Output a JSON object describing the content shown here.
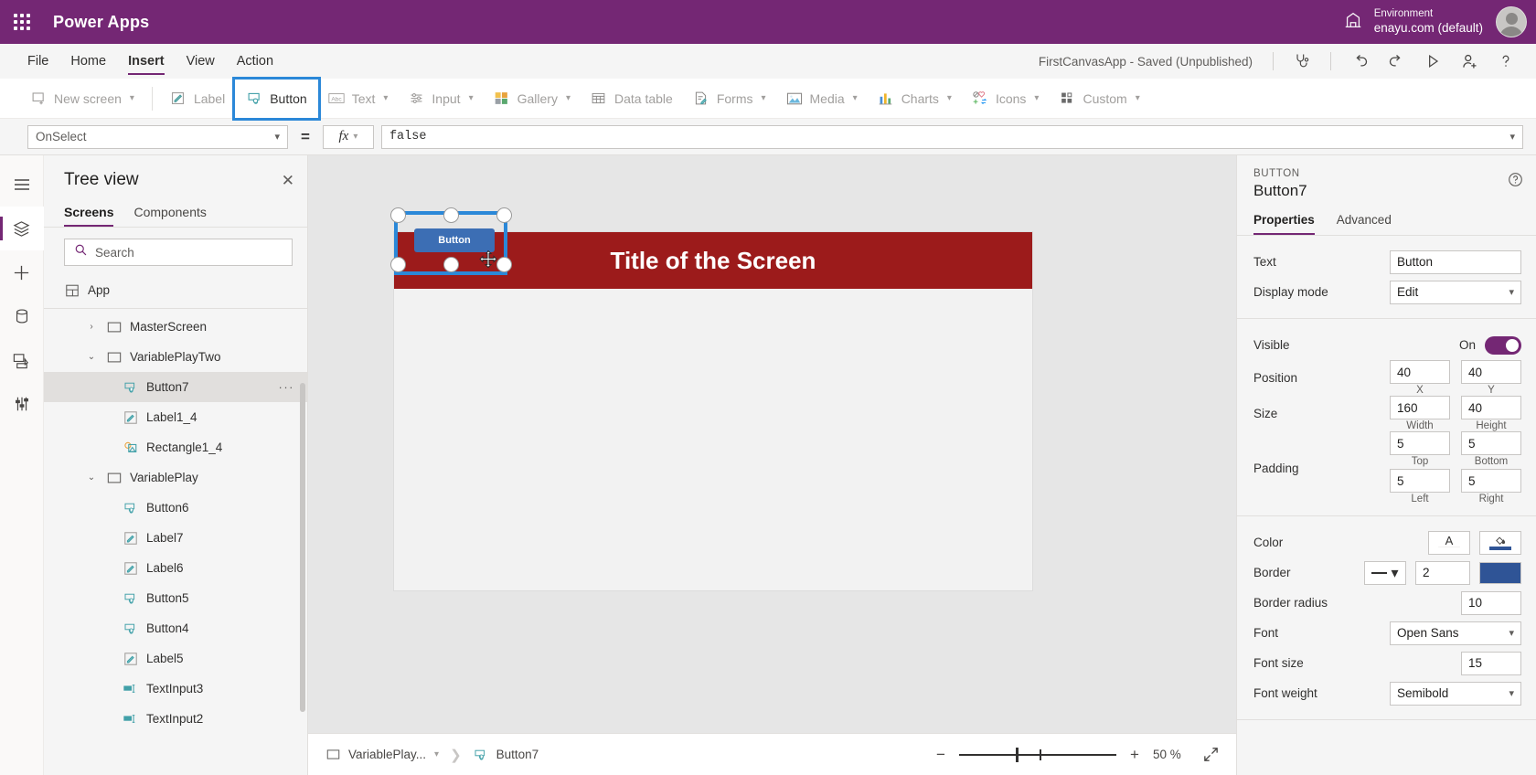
{
  "topbar": {
    "waffle_icon": "app-launcher-icon",
    "brand": "Power Apps",
    "environment_icon": "environment-icon",
    "environment_label": "Environment",
    "environment_name": "enayu.com (default)",
    "avatar": "user-avatar"
  },
  "menubar": {
    "items": [
      {
        "label": "File",
        "active": false
      },
      {
        "label": "Home",
        "active": false
      },
      {
        "label": "Insert",
        "active": true
      },
      {
        "label": "View",
        "active": false
      },
      {
        "label": "Action",
        "active": false
      }
    ],
    "app_status": "FirstCanvasApp - Saved (Unpublished)",
    "icons": [
      {
        "name": "app-checker-icon",
        "glyph": "⚕"
      },
      {
        "name": "undo-icon",
        "glyph": "↶"
      },
      {
        "name": "redo-icon",
        "glyph": "↷"
      },
      {
        "name": "preview-play-icon",
        "glyph": "▷"
      },
      {
        "name": "share-user-icon",
        "glyph": "&"
      },
      {
        "name": "help-icon",
        "glyph": "?"
      }
    ]
  },
  "ribbon": {
    "items": [
      {
        "label": "New screen",
        "icon": "new-screen-icon",
        "caret": true,
        "selected": false
      },
      {
        "label": "Label",
        "icon": "label-icon",
        "caret": false,
        "selected": false
      },
      {
        "label": "Button",
        "icon": "button-icon",
        "caret": false,
        "selected": true
      },
      {
        "label": "Text",
        "icon": "text-icon",
        "caret": true,
        "selected": false
      },
      {
        "label": "Input",
        "icon": "input-icon",
        "caret": true,
        "selected": false
      },
      {
        "label": "Gallery",
        "icon": "gallery-icon",
        "caret": true,
        "selected": false
      },
      {
        "label": "Data table",
        "icon": "data-table-icon",
        "caret": false,
        "selected": false
      },
      {
        "label": "Forms",
        "icon": "forms-icon",
        "caret": true,
        "selected": false
      },
      {
        "label": "Media",
        "icon": "media-icon",
        "caret": true,
        "selected": false
      },
      {
        "label": "Charts",
        "icon": "charts-icon",
        "caret": true,
        "selected": false
      },
      {
        "label": "Icons",
        "icon": "icons-icon",
        "caret": true,
        "selected": false
      },
      {
        "label": "Custom",
        "icon": "custom-icon",
        "caret": true,
        "selected": false
      }
    ],
    "selection_color": "#2b88d8"
  },
  "formula_bar": {
    "property": "OnSelect",
    "equals": "=",
    "fx_label": "fx",
    "value": "false"
  },
  "rail": {
    "items": [
      {
        "name": "hamburger-menu-icon"
      },
      {
        "name": "tree-view-icon",
        "active": true
      },
      {
        "name": "insert-plus-icon"
      },
      {
        "name": "data-sources-icon"
      },
      {
        "name": "media-library-icon"
      },
      {
        "name": "advanced-tools-icon"
      }
    ]
  },
  "tree_view": {
    "title": "Tree view",
    "close_icon": "close-icon",
    "tabs": [
      {
        "label": "Screens",
        "active": true
      },
      {
        "label": "Components",
        "active": false
      }
    ],
    "search_placeholder": "Search",
    "search_icon": "search-icon",
    "app_item": {
      "label": "App",
      "icon": "app-icon"
    },
    "items": [
      {
        "label": "MasterScreen",
        "icon": "screen-icon",
        "level": "screen",
        "twisty": "›",
        "selected": false,
        "dots": false
      },
      {
        "label": "VariablePlayTwo",
        "icon": "screen-icon",
        "level": "screen",
        "twisty": "⌄",
        "selected": false,
        "dots": false
      },
      {
        "label": "Button7",
        "icon": "button-icon",
        "level": "ctrl",
        "twisty": "",
        "selected": true,
        "dots": true
      },
      {
        "label": "Label1_4",
        "icon": "label-icon",
        "level": "ctrl",
        "twisty": "",
        "selected": false,
        "dots": false
      },
      {
        "label": "Rectangle1_4",
        "icon": "shape-icon",
        "level": "ctrl",
        "twisty": "",
        "selected": false,
        "dots": false
      },
      {
        "label": "VariablePlay",
        "icon": "screen-icon",
        "level": "screen",
        "twisty": "⌄",
        "selected": false,
        "dots": false
      },
      {
        "label": "Button6",
        "icon": "button-icon",
        "level": "ctrl",
        "twisty": "",
        "selected": false,
        "dots": false
      },
      {
        "label": "Label7",
        "icon": "label-icon",
        "level": "ctrl",
        "twisty": "",
        "selected": false,
        "dots": false
      },
      {
        "label": "Label6",
        "icon": "label-icon",
        "level": "ctrl",
        "twisty": "",
        "selected": false,
        "dots": false
      },
      {
        "label": "Button5",
        "icon": "button-icon",
        "level": "ctrl",
        "twisty": "",
        "selected": false,
        "dots": false
      },
      {
        "label": "Button4",
        "icon": "button-icon",
        "level": "ctrl",
        "twisty": "",
        "selected": false,
        "dots": false
      },
      {
        "label": "Label5",
        "icon": "label-icon",
        "level": "ctrl",
        "twisty": "",
        "selected": false,
        "dots": false
      },
      {
        "label": "TextInput3",
        "icon": "text-input-icon",
        "level": "ctrl",
        "twisty": "",
        "selected": false,
        "dots": false
      },
      {
        "label": "TextInput2",
        "icon": "text-input-icon",
        "level": "ctrl",
        "twisty": "",
        "selected": false,
        "dots": false
      }
    ]
  },
  "canvas": {
    "screen_title": "Title of the Screen",
    "title_bar_color": "#9c1b1b",
    "screen_bg": "#f2f2f2",
    "selected_control_text": "Button",
    "selected_control_fill": "#3c6eb4",
    "selection_outline_color": "#2b88d8",
    "cursor": "move-cursor"
  },
  "statusbar": {
    "breadcrumb_screen": "VariablePlay...",
    "breadcrumb_screen_icon": "screen-icon",
    "breadcrumb_control": "Button7",
    "breadcrumb_control_icon": "button-icon",
    "zoom_out_icon": "minus-icon",
    "zoom_in_icon": "plus-icon",
    "zoom_value": "50",
    "zoom_unit": "%",
    "fit_icon": "fit-to-screen-icon"
  },
  "properties_panel": {
    "kind": "BUTTON",
    "name": "Button7",
    "help_icon": "help-circle-icon",
    "tabs": [
      {
        "label": "Properties",
        "active": true
      },
      {
        "label": "Advanced",
        "active": false
      }
    ],
    "text": {
      "label": "Text",
      "value": "Button"
    },
    "display_mode": {
      "label": "Display mode",
      "value": "Edit"
    },
    "visible": {
      "label": "Visible",
      "state": "On",
      "on": true
    },
    "position": {
      "label": "Position",
      "x": "40",
      "y": "40",
      "x_caption": "X",
      "y_caption": "Y"
    },
    "size": {
      "label": "Size",
      "width": "160",
      "height": "40",
      "width_caption": "Width",
      "height_caption": "Height"
    },
    "padding": {
      "label": "Padding",
      "top": "5",
      "bottom": "5",
      "left": "5",
      "right": "5",
      "top_caption": "Top",
      "bottom_caption": "Bottom",
      "left_caption": "Left",
      "right_caption": "Right"
    },
    "color": {
      "label": "Color",
      "text_color_icon": "font-color-icon",
      "fill_icon": "fill-bucket-icon",
      "text_color_swatch": "#000000",
      "fill_swatch": "#3c6eb4"
    },
    "border": {
      "label": "Border",
      "style_icon": "line-style-icon",
      "width": "2",
      "color_swatch": "#2f5496"
    },
    "border_radius": {
      "label": "Border radius",
      "value": "10"
    },
    "font": {
      "label": "Font",
      "value": "Open Sans"
    },
    "font_size": {
      "label": "Font size",
      "value": "15"
    },
    "font_weight": {
      "label": "Font weight",
      "value": "Semibold"
    }
  }
}
